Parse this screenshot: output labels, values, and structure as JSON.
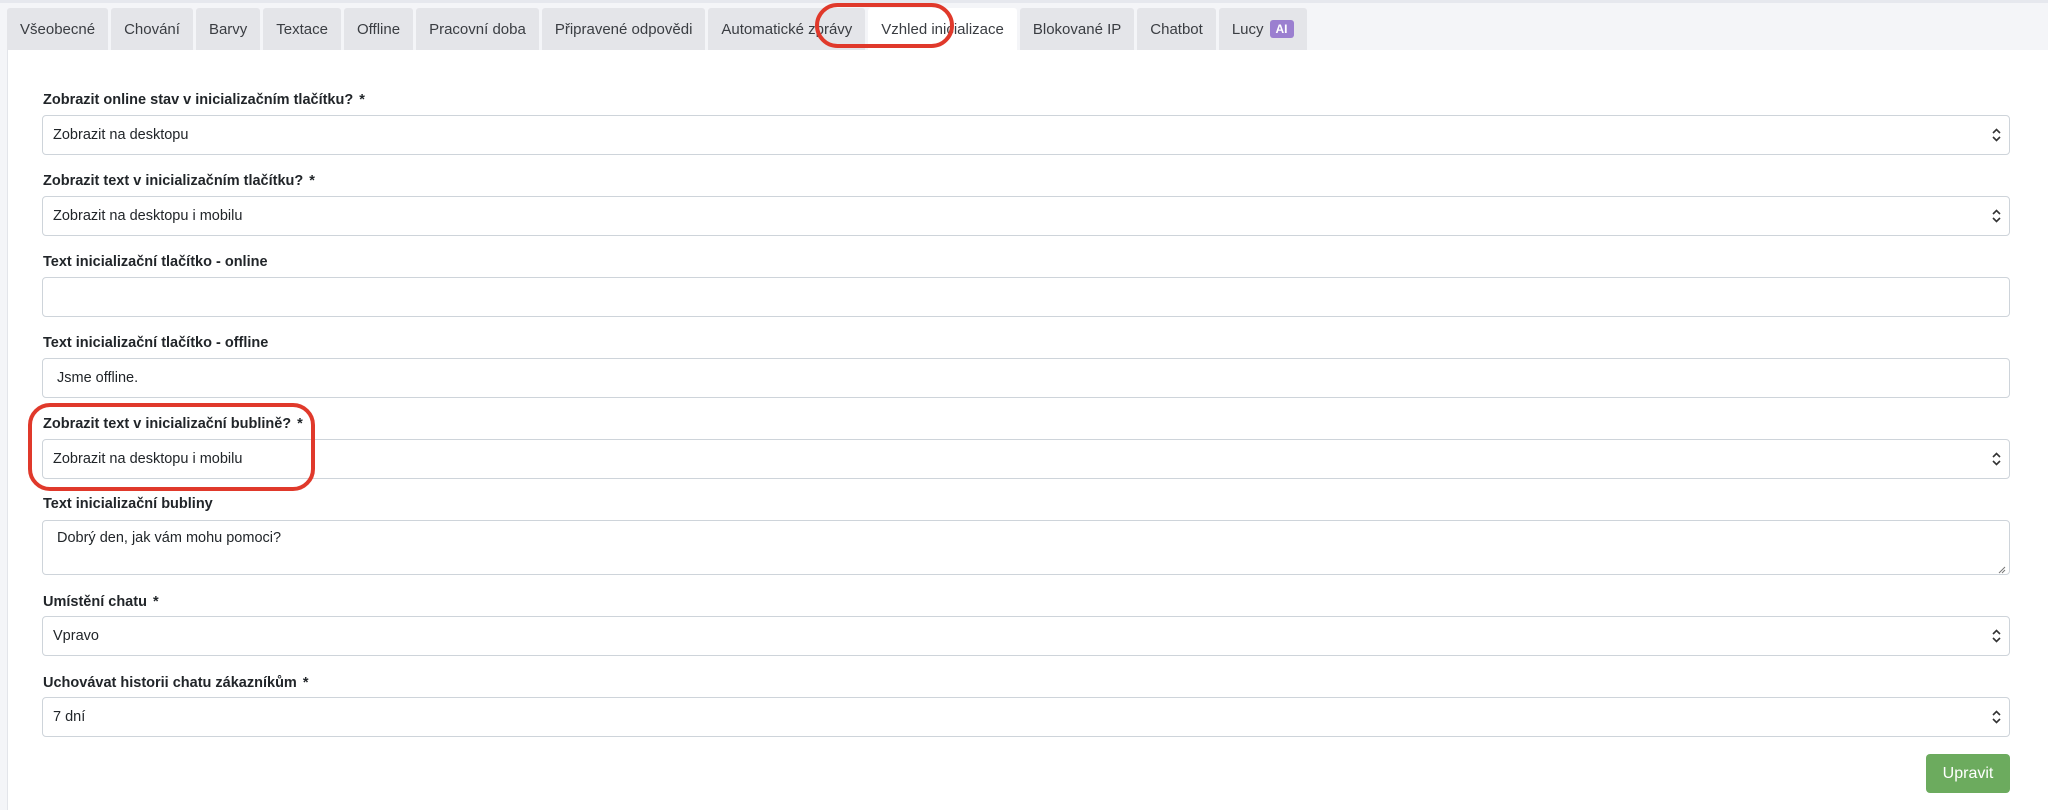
{
  "tabs": [
    {
      "label": "Všeobecné"
    },
    {
      "label": "Chování"
    },
    {
      "label": "Barvy"
    },
    {
      "label": "Textace"
    },
    {
      "label": "Offline"
    },
    {
      "label": "Pracovní doba"
    },
    {
      "label": "Připravené odpovědi"
    },
    {
      "label": "Automatické zprávy"
    },
    {
      "label": "Vzhled inicializace",
      "active": true
    },
    {
      "label": "Blokované IP"
    },
    {
      "label": "Chatbot"
    },
    {
      "label": "Lucy",
      "badge": "AI"
    }
  ],
  "form": {
    "online_status": {
      "label": "Zobrazit online stav v inicializačním tlačítku?",
      "required_mark": "*",
      "value": "Zobrazit na desktopu"
    },
    "button_text_visibility": {
      "label": "Zobrazit text v inicializačním tlačítku?",
      "required_mark": "*",
      "value": "Zobrazit na desktopu i mobilu"
    },
    "button_text_online": {
      "label": "Text inicializační tlačítko - online",
      "value": ""
    },
    "button_text_offline": {
      "label": "Text inicializační tlačítko - offline",
      "value": "Jsme offline."
    },
    "bubble_text_visibility": {
      "label": "Zobrazit text v inicializační bublině?",
      "required_mark": "*",
      "value": "Zobrazit na desktopu i mobilu"
    },
    "bubble_text": {
      "label": "Text inicializační bubliny",
      "value": "Dobrý den, jak vám mohu pomoci?"
    },
    "chat_position": {
      "label": "Umístění chatu",
      "required_mark": "*",
      "value": "Vpravo"
    },
    "history_retention": {
      "label": "Uchovávat historii chatu zákazníkům",
      "required_mark": "*",
      "value": "7 dní"
    },
    "submit_label": "Upravit"
  },
  "colors": {
    "highlight": "#e0392b",
    "submit": "#6cab5e",
    "ai_badge": "#9b7fd0"
  }
}
